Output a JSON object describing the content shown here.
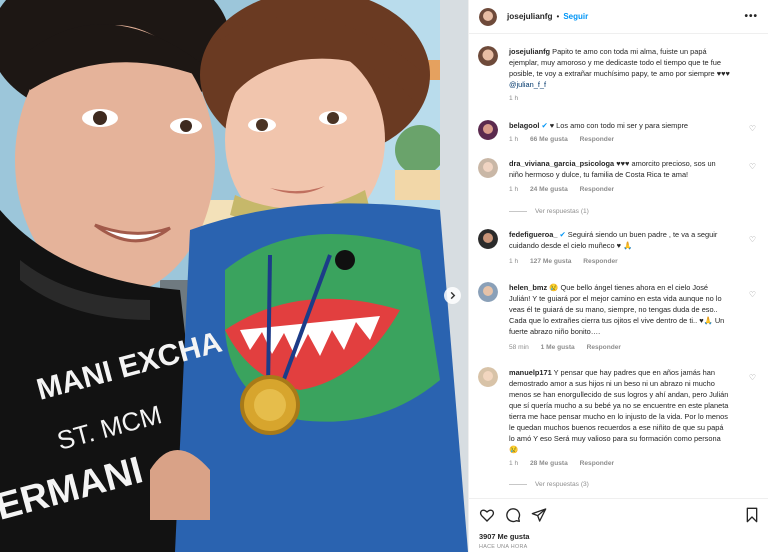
{
  "post": {
    "author": "josejulianfg",
    "follow_label": "Seguir",
    "dot": "•",
    "more_icon": "more-horizontal-icon",
    "photo_text": {
      "shirt_line1": "MANI EXCHA",
      "shirt_line2": "ST. MCM",
      "shirt_line3": "ERMANI",
      "medal": "medal"
    }
  },
  "caption": {
    "user": "josejulianfg",
    "text": "Papito te amo con toda mi alma, fuiste un papá ejemplar, muy amoroso y me dedicaste todo el tiempo que te fue posible, te voy a extrañar muchísimo papy, te amo por siempre ♥♥♥",
    "mention": "@julian_f_f",
    "time": "1 h"
  },
  "comments": [
    {
      "user": "belagool",
      "verified": "✔",
      "text": "♥ Los amo con todo mi ser y para siempre",
      "time": "1 h",
      "likes": "66 Me gusta",
      "reply": "Responder"
    },
    {
      "user": "dra_viviana_garcia_psicologa",
      "text": "♥♥♥ amorcito precioso, sos un niño hermoso y dulce, tu familia de Costa Rica te ama!",
      "time": "1 h",
      "likes": "24 Me gusta",
      "reply": "Responder",
      "replies": "Ver respuestas (1)"
    },
    {
      "user": "fedefigueroa_",
      "verified": "✔",
      "text": "Seguirá siendo un buen padre , te va a seguir cuidando desde el cielo muñeco ♥ 🙏",
      "time": "1 h",
      "likes": "127 Me gusta",
      "reply": "Responder"
    },
    {
      "user": "helen_bmz",
      "text": "😢 Que bello ángel tienes ahora en el cielo José Julián! Y te guiará por el mejor camino en esta vida aunque no lo veas él te guiará de su mano, siempre, no tengas duda de eso.. Cada que lo extrañes cierra tus ojitos el vive dentro de ti.. ♥🙏 Un fuerte abrazo niño bonito….",
      "time": "58 min",
      "likes": "1 Me gusta",
      "reply": "Responder"
    },
    {
      "user": "manuelp171",
      "text": "Y pensar que hay padres que en años jamás han demostrado amor a sus hijos ni un beso ni un abrazo ni mucho menos se han enorgullecido de sus logros y ahí andan, pero Julián que sí quería mucho a su bebé ya no se encuentre en este planeta tierra me hace pensar mucho en lo injusto de la vida. Por lo menos le quedan muchos buenos recuerdos a ese niñito de que su papá lo amó Y eso Será muy valioso para su formación como persona 😢",
      "time": "1 h",
      "likes": "28 Me gusta",
      "reply": "Responder",
      "replies": "Ver respuestas (3)"
    }
  ],
  "footer": {
    "likes": "3907 Me gusta",
    "time": "HACE UNA HORA",
    "icons": [
      "heart-icon",
      "comment-icon",
      "share-icon",
      "bookmark-icon"
    ]
  },
  "colors": {
    "accent": "#0095f6",
    "muted": "#8e8e8e",
    "heart_red": "#ed4956"
  }
}
